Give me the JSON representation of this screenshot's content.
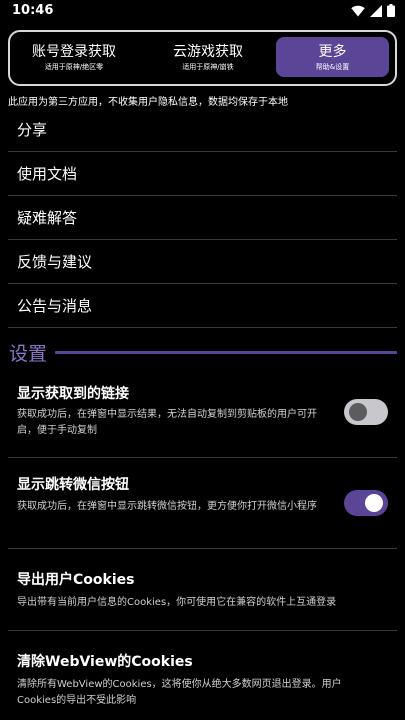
{
  "status_bar": {
    "time": "10:46",
    "icons": [
      "wifi-icon",
      "signal-icon",
      "battery-icon"
    ]
  },
  "tabs": [
    {
      "label": "账号登录获取",
      "sub": "适用于原神/绝区零",
      "active": false
    },
    {
      "label": "云游戏获取",
      "sub": "适用于原神/崩铁",
      "active": false
    },
    {
      "label": "更多",
      "sub": "帮助&设置",
      "active": true
    }
  ],
  "privacy_note": "此应用为第三方应用，不收集用户隐私信息，数据均保存于本地",
  "menu": [
    "分享",
    "使用文档",
    "疑难解答",
    "反馈与建议",
    "公告与消息"
  ],
  "settings": {
    "title": "设置",
    "items": [
      {
        "title": "显示获取到的链接",
        "desc": "获取成功后，在弹窗中显示结果，无法自动复制到剪贴板的用户可开启，便于手动复制",
        "toggle": false
      },
      {
        "title": "显示跳转微信按钮",
        "desc": "获取成功后，在弹窗中显示跳转微信按钮，更方便你打开微信小程序",
        "toggle": true
      },
      {
        "title": "导出用户Cookies",
        "desc": "导出带有当前用户信息的Cookies，你可使用它在兼容的软件上互通登录"
      },
      {
        "title": "清除WebView的Cookies",
        "desc": "清除所有WebView的Cookies，这将使你从绝大多数网页退出登录。用户Cookies的导出不受此影响"
      }
    ]
  },
  "colors": {
    "accent": "#5a4596",
    "accent_text": "#8a74c8",
    "background": "#000000"
  }
}
